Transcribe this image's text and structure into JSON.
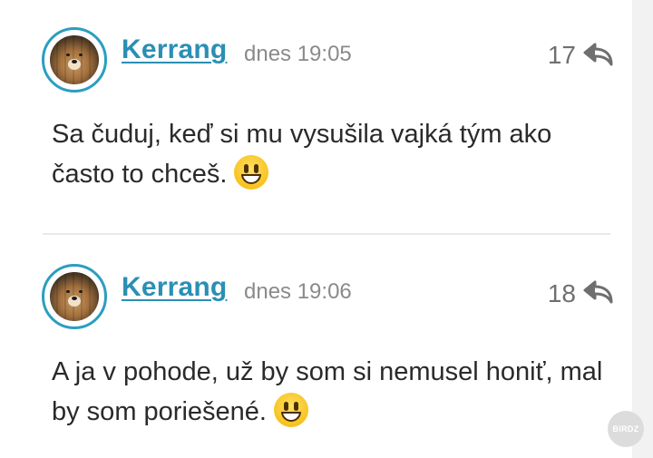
{
  "comments": [
    {
      "username": "Kerrang",
      "time": "dnes 19:05",
      "votes": "17",
      "text": "Sa čuduj, keď si mu vysušila vajká tým ako často to chceš.",
      "emoji_icon": "grinning-face-emoji"
    },
    {
      "username": "Kerrang",
      "time": "dnes 19:06",
      "votes": "18",
      "text": "A ja v pohode, už by som si nemusel honiť, mal by som poriešené.",
      "emoji_icon": "grinning-face-emoji"
    }
  ],
  "watermark": "BIRDZ",
  "colors": {
    "username": "#2b8fb4",
    "avatar_ring": "#2b9ec0",
    "muted": "#8a8a8a"
  }
}
